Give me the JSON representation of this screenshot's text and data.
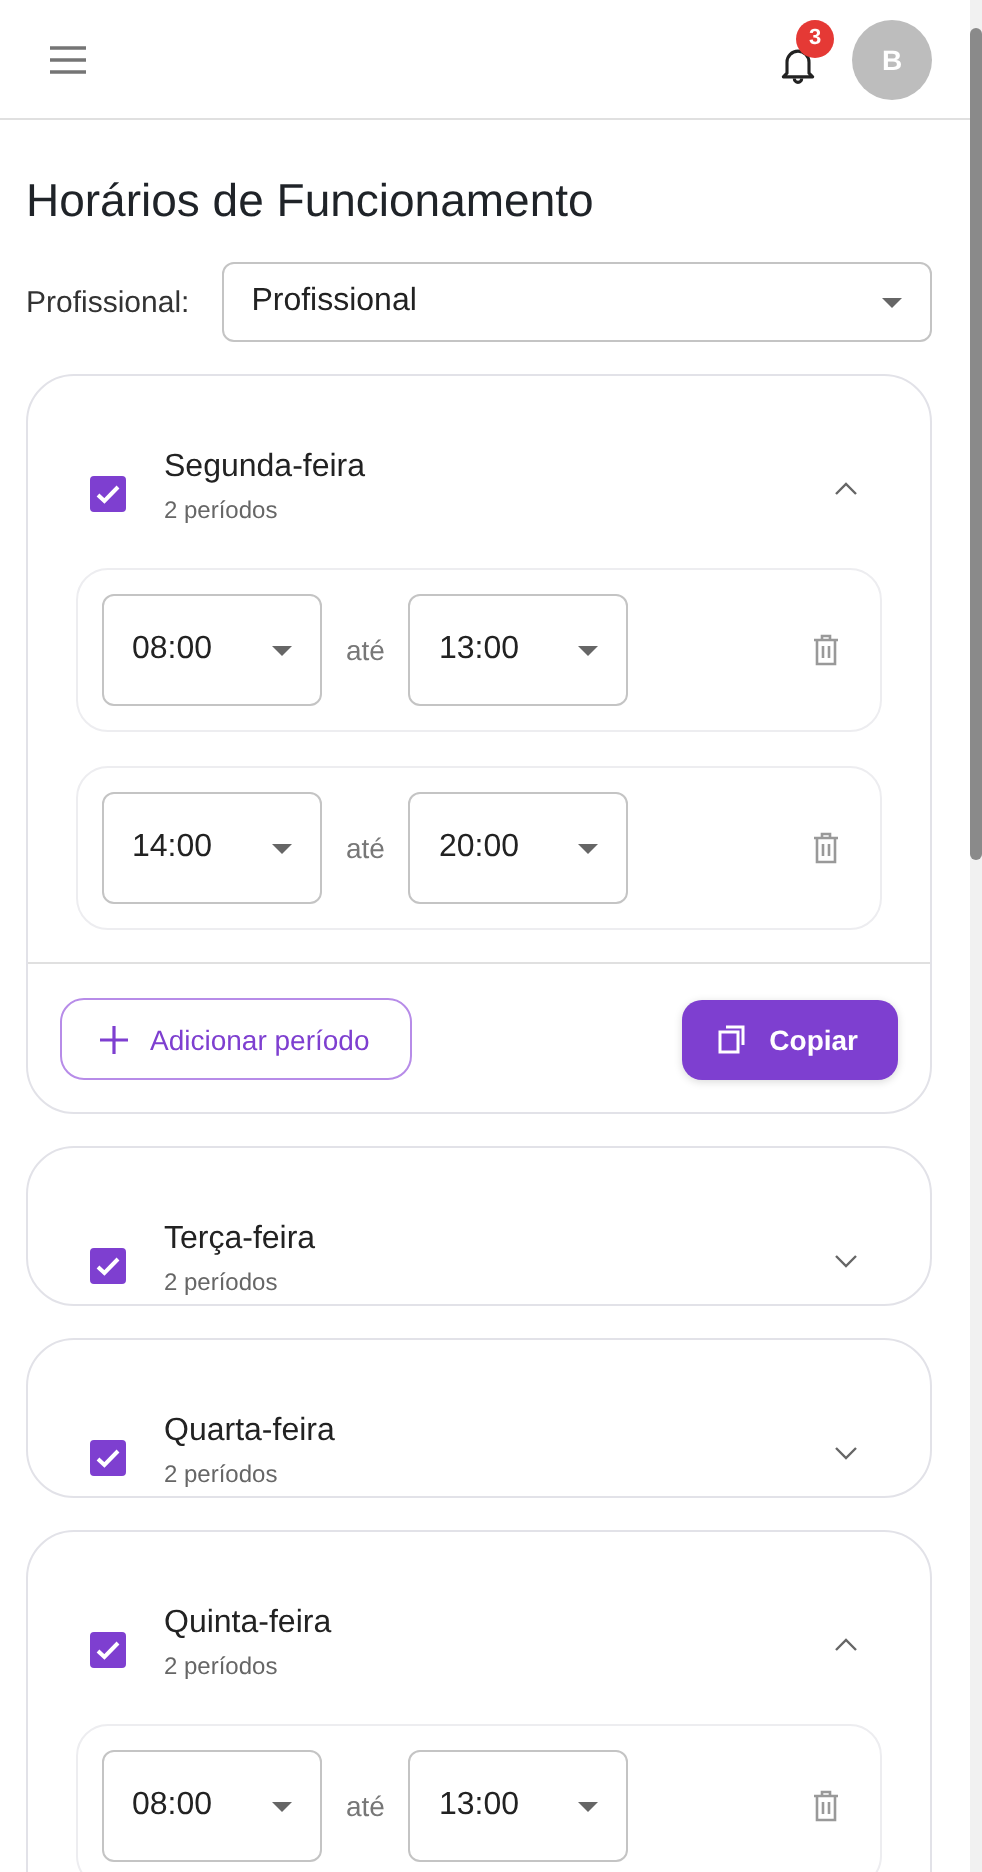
{
  "header": {
    "notification_count": "3",
    "avatar_initial": "B"
  },
  "title": "Horários de Funcionamento",
  "professional_filter": {
    "label": "Profissional:",
    "value": "Profissional"
  },
  "days": [
    {
      "name": "Segunda-feira",
      "subtitle": "2 períodos",
      "checked": true,
      "expanded": true,
      "periods": [
        {
          "start": "08:00",
          "separator": "até",
          "end": "13:00"
        },
        {
          "start": "14:00",
          "separator": "até",
          "end": "20:00"
        }
      ],
      "actions": {
        "add": "Adicionar período",
        "copy": "Copiar"
      }
    },
    {
      "name": "Terça-feira",
      "subtitle": "2 períodos",
      "checked": true,
      "expanded": false
    },
    {
      "name": "Quarta-feira",
      "subtitle": "2 períodos",
      "checked": true,
      "expanded": false
    },
    {
      "name": "Quinta-feira",
      "subtitle": "2 períodos",
      "checked": true,
      "expanded": true,
      "periods": [
        {
          "start": "08:00",
          "separator": "até",
          "end": "13:00"
        }
      ]
    }
  ]
}
